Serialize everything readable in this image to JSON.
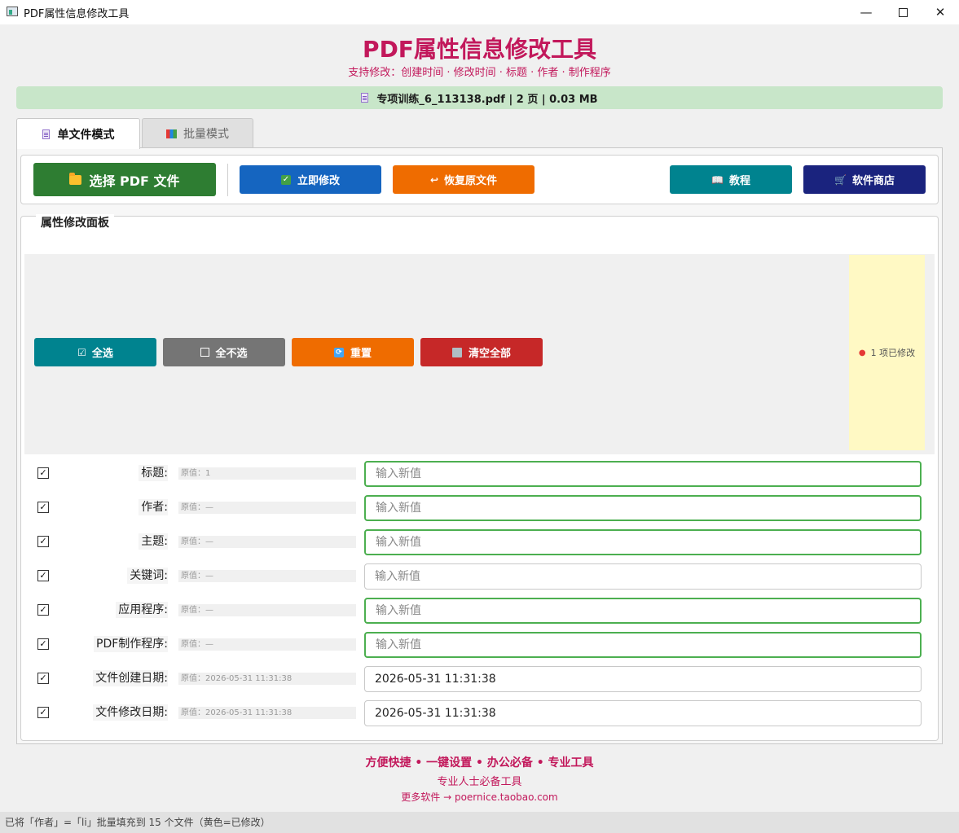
{
  "window": {
    "title": "PDF属性信息修改工具"
  },
  "header": {
    "title": "PDF属性信息修改工具",
    "subtitle": "支持修改：创建时间 · 修改时间 · 标题 · 作者 · 制作程序"
  },
  "file_info": {
    "text": "专项训练_6_113138.pdf | 2 页 | 0.03 MB"
  },
  "tabs": [
    {
      "label": "单文件模式",
      "active": true
    },
    {
      "label": "批量模式",
      "active": false
    }
  ],
  "toolbar": {
    "select_label": "选择 PDF 文件",
    "apply_label": "立即修改",
    "restore_label": "恢复原文件",
    "restore_icon": "↩",
    "tutorial_label": "教程",
    "tutorial_icon": "📖",
    "store_label": "软件商店",
    "store_icon": "🛒"
  },
  "panel": {
    "legend": "属性修改面板",
    "actions": {
      "select_all": "全选",
      "select_none": "全不选",
      "reset": "重置",
      "clear_all": "清空全部"
    },
    "modified_status": "1 项已修改",
    "rows": [
      {
        "label": "标题:",
        "original": "原值：1",
        "value": "",
        "placeholder": "输入新值",
        "checked": true
      },
      {
        "label": "作者:",
        "original": "原值：—",
        "value": "",
        "placeholder": "输入新值",
        "checked": true
      },
      {
        "label": "主题:",
        "original": "原值：—",
        "value": "",
        "placeholder": "输入新值",
        "checked": true
      },
      {
        "label": "关键词:",
        "original": "原值：—",
        "value": "",
        "placeholder": "输入新值",
        "checked": true
      },
      {
        "label": "应用程序:",
        "original": "原值：—",
        "value": "",
        "placeholder": "输入新值",
        "checked": true
      },
      {
        "label": "PDF制作程序:",
        "original": "原值：—",
        "value": "",
        "placeholder": "输入新值",
        "checked": true
      },
      {
        "label": "文件创建日期:",
        "original": "原值：2026-05-31 11:31:38",
        "value": "2026-05-31 11:31:38",
        "placeholder": "",
        "checked": true
      },
      {
        "label": "文件修改日期:",
        "original": "原值：2026-05-31 11:31:38",
        "value": "2026-05-31 11:31:38",
        "placeholder": "",
        "checked": true
      }
    ]
  },
  "footer": {
    "slogan": "方便快捷 • 一键设置 • 办公必备 • 专业工具",
    "tagline": "专业人士必备工具",
    "link": "更多软件 → poernice.taobao.com"
  },
  "status_bar": {
    "text": "已将「作者」=「li」批量填充到 15 个文件（黄色=已修改）"
  },
  "colors": {
    "accent": "#c2185b",
    "file_bar": "#c8e6c9",
    "select_button": "#2e7d32",
    "apply_button": "#1565c0",
    "restore_button": "#ef6c00",
    "tutorial_button": "#00838f",
    "store_button": "#1a237e",
    "clear_button": "#c62828",
    "modified_highlight": "#fff9c4",
    "modified_border": "#4caf50"
  }
}
